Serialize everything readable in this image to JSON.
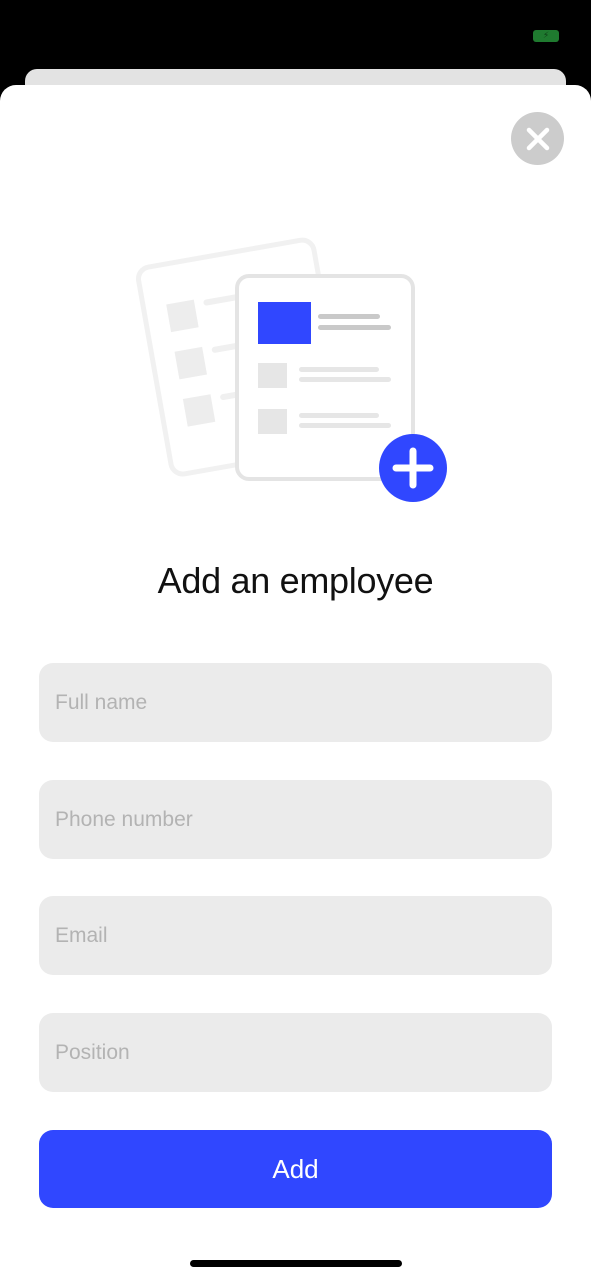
{
  "status_bar": {
    "battery_icon": "battery-charging-icon"
  },
  "close_icon": "close-icon",
  "illustration_icon": "add-document-icon",
  "title": "Add an employee",
  "fields": {
    "full_name": {
      "placeholder": "Full name",
      "value": ""
    },
    "phone": {
      "placeholder": "Phone number",
      "value": ""
    },
    "email": {
      "placeholder": "Email",
      "value": ""
    },
    "position": {
      "placeholder": "Position",
      "value": ""
    }
  },
  "add_button": {
    "label": "Add"
  },
  "colors": {
    "accent": "#3047ff",
    "field_background": "#ebebeb",
    "placeholder": "#b3b3b3",
    "close_background": "#cccccc"
  }
}
